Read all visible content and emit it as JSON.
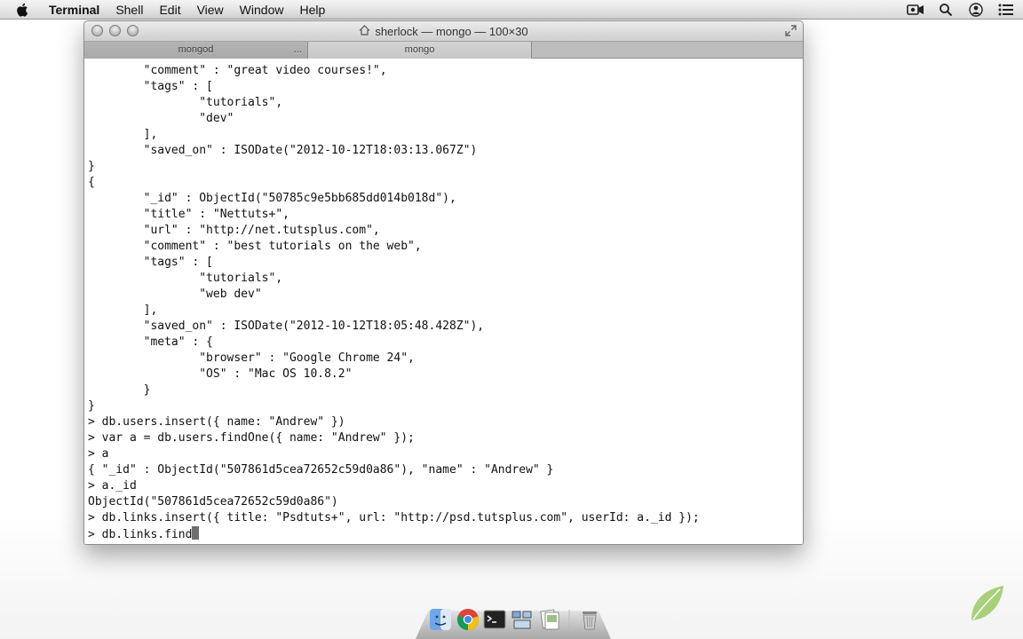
{
  "menubar": {
    "app_name": "Terminal",
    "items": [
      "Shell",
      "Edit",
      "View",
      "Window",
      "Help"
    ]
  },
  "window": {
    "title": "sherlock — mongo — 100×30",
    "tabs": [
      {
        "label": "mongod",
        "suffix": "...",
        "active": false
      },
      {
        "label": "mongo",
        "active": true
      }
    ]
  },
  "console": {
    "lines": [
      "        \"comment\" : \"great video courses!\",",
      "        \"tags\" : [",
      "                \"tutorials\",",
      "                \"dev\"",
      "        ],",
      "        \"saved_on\" : ISODate(\"2012-10-12T18:03:13.067Z\")",
      "}",
      "{",
      "        \"_id\" : ObjectId(\"50785c9e5bb685dd014b018d\"),",
      "        \"title\" : \"Nettuts+\",",
      "        \"url\" : \"http://net.tutsplus.com\",",
      "        \"comment\" : \"best tutorials on the web\",",
      "        \"tags\" : [",
      "                \"tutorials\",",
      "                \"web dev\"",
      "        ],",
      "        \"saved_on\" : ISODate(\"2012-10-12T18:05:48.428Z\"),",
      "        \"meta\" : {",
      "                \"browser\" : \"Google Chrome 24\",",
      "                \"OS\" : \"Mac OS 10.8.2\"",
      "        }",
      "}",
      "> db.users.insert({ name: \"Andrew\" })",
      "> var a = db.users.findOne({ name: \"Andrew\" });",
      "> a",
      "{ \"_id\" : ObjectId(\"507861d5cea72652c59d0a86\"), \"name\" : \"Andrew\" }",
      "> a._id",
      "ObjectId(\"507861d5cea72652c59d0a86\")",
      "> db.links.insert({ title: \"Psdtuts+\", url: \"http://psd.tutsplus.com\", userId: a._id });"
    ],
    "prompt_line": "> db.links.find"
  },
  "colors": {
    "terminal_bg": "#ffffff",
    "terminal_text": "#111111",
    "cursor": "#6e6e6e"
  },
  "dock": {
    "icons": [
      "finder-icon",
      "chrome-icon",
      "terminal-icon",
      "mission-control-icon",
      "preview-icon",
      "trash-icon"
    ]
  }
}
